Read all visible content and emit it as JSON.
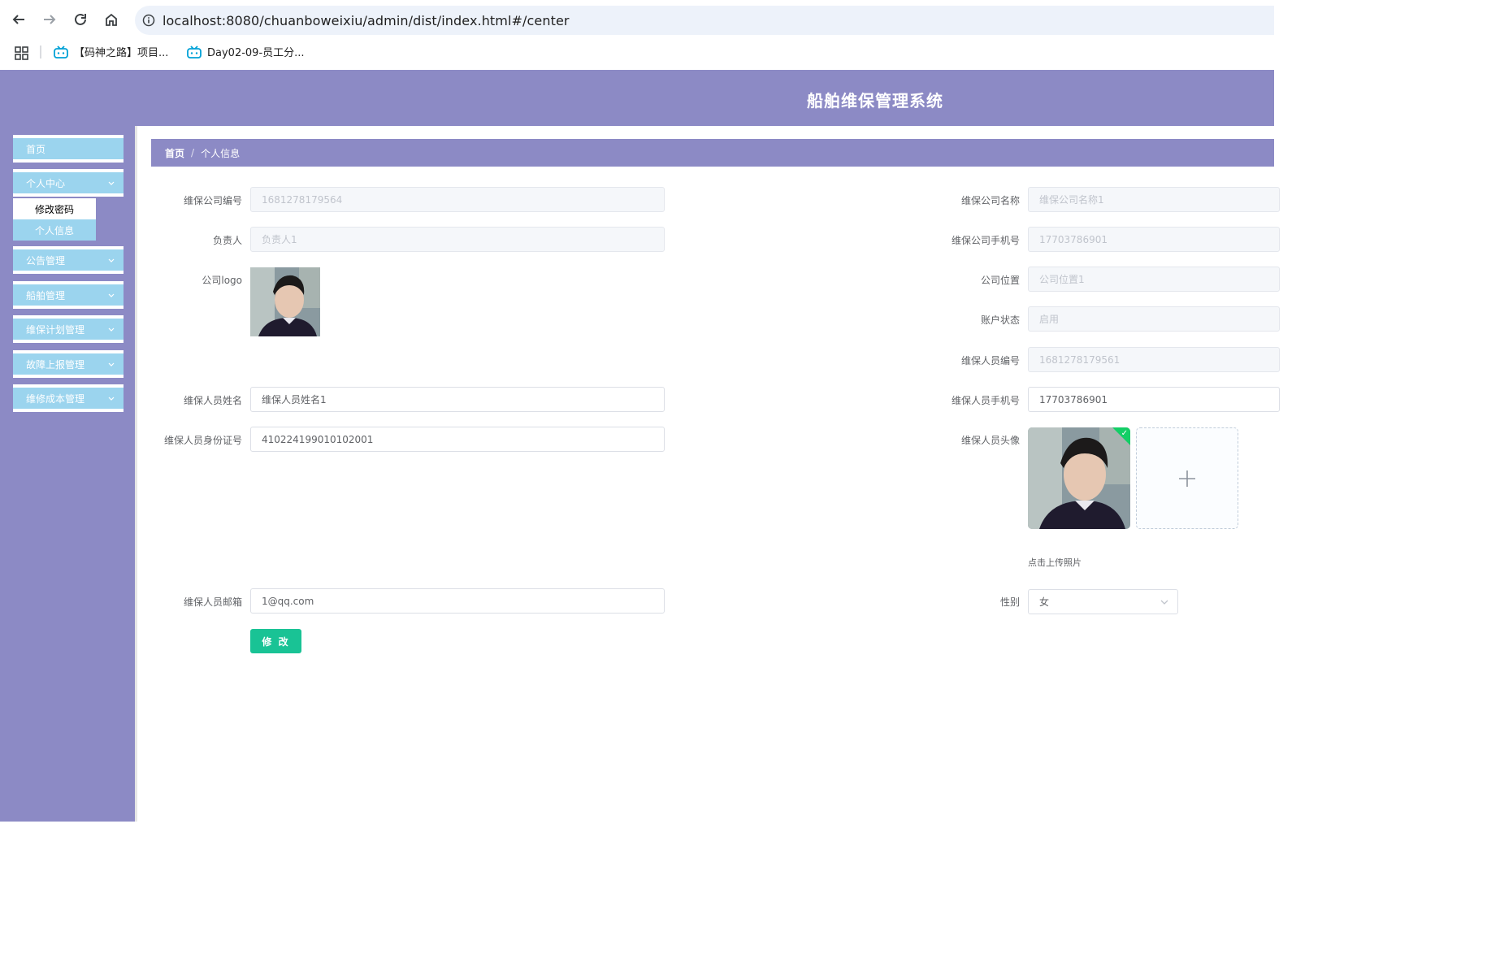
{
  "browser": {
    "url": "localhost:8080/chuanboweixiu/admin/dist/index.html#/center",
    "bookmarks": [
      {
        "label": "【码神之路】项目..."
      },
      {
        "label": "Day02-09-员工分..."
      }
    ]
  },
  "app": {
    "title": "船舶维保管理系统"
  },
  "sidebar": {
    "items": [
      {
        "label": "首页"
      },
      {
        "label": "个人中心"
      },
      {
        "label": "公告管理"
      },
      {
        "label": "船舶管理"
      },
      {
        "label": "维保计划管理"
      },
      {
        "label": "故障上报管理"
      },
      {
        "label": "维修成本管理"
      }
    ],
    "submenu": [
      {
        "label": "修改密码"
      },
      {
        "label": "个人信息"
      }
    ]
  },
  "breadcrumb": {
    "home": "首页",
    "separator": "/",
    "current": "个人信息"
  },
  "form": {
    "company_no": {
      "label": "维保公司编号",
      "value": "1681278179564"
    },
    "company_name": {
      "label": "维保公司名称",
      "value": "维保公司名称1"
    },
    "manager": {
      "label": "负责人",
      "value": "负责人1"
    },
    "company_phone": {
      "label": "维保公司手机号",
      "value": "17703786901"
    },
    "company_logo": {
      "label": "公司logo"
    },
    "company_location": {
      "label": "公司位置",
      "value": "公司位置1"
    },
    "account_status": {
      "label": "账户状态",
      "value": "启用"
    },
    "staff_no": {
      "label": "维保人员编号",
      "value": "1681278179561"
    },
    "staff_name": {
      "label": "维保人员姓名",
      "value": "维保人员姓名1"
    },
    "staff_phone": {
      "label": "维保人员手机号",
      "value": "17703786901"
    },
    "staff_id": {
      "label": "维保人员身份证号",
      "value": "410224199010102001"
    },
    "staff_avatar": {
      "label": "维保人员头像",
      "upload_tip": "点击上传照片"
    },
    "staff_email": {
      "label": "维保人员邮箱",
      "value": "1@qq.com"
    },
    "gender": {
      "label": "性别",
      "value": "女"
    },
    "submit_label": "修 改"
  },
  "colors": {
    "header": "#8c8ac5",
    "menu": "#9bd4ee",
    "primary_button": "#19c395",
    "upload_success": "#13ce66"
  },
  "icons": [
    "back-arrow-icon",
    "forward-arrow-icon",
    "reload-icon",
    "home-icon",
    "site-info-icon",
    "apps-grid-icon",
    "bilibili-icon",
    "chevron-down-icon",
    "plus-icon",
    "check-icon"
  ]
}
